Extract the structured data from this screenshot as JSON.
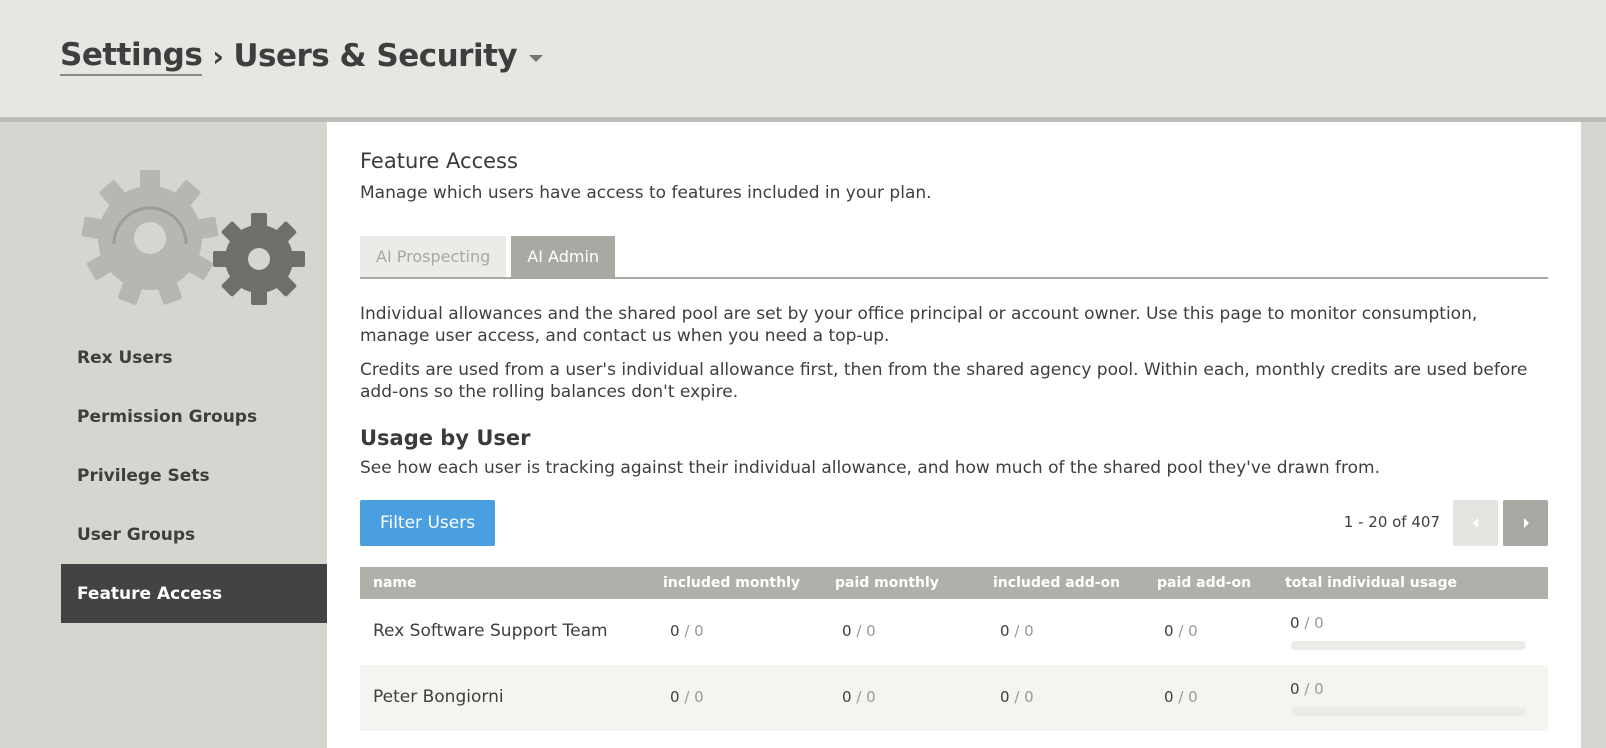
{
  "header": {
    "breadcrumb_parent": "Settings",
    "breadcrumb_separator": "›",
    "breadcrumb_current": "Users & Security"
  },
  "sidebar": {
    "items": [
      {
        "label": "Rex Users",
        "active": false
      },
      {
        "label": "Permission Groups",
        "active": false
      },
      {
        "label": "Privilege Sets",
        "active": false
      },
      {
        "label": "User Groups",
        "active": false
      },
      {
        "label": "Feature Access",
        "active": true
      }
    ]
  },
  "main": {
    "title": "Feature Access",
    "subtitle": "Manage which users have access to features included in your plan.",
    "tabs": [
      {
        "label": "AI Prospecting",
        "active": false
      },
      {
        "label": "AI Admin",
        "active": true
      }
    ],
    "paragraphs": [
      "Individual allowances and the shared pool are set by your office principal or account owner. Use this page to monitor consumption, manage user access, and contact us when you need a top-up.",
      "Credits are used from a user's individual allowance first, then from the shared agency pool. Within each, monthly credits are used before add-ons so the rolling balances don't expire."
    ],
    "usage": {
      "title": "Usage by User",
      "subtitle": "See how each user is tracking against their individual allowance, and how much of the shared pool they've drawn from.",
      "filter_label": "Filter Users",
      "pager_text": "1 - 20 of 407",
      "columns": [
        "name",
        "included monthly",
        "paid monthly",
        "included add-on",
        "paid add-on",
        "total individual usage"
      ],
      "rows": [
        {
          "name": "Rex Software Support Team",
          "included_monthly": {
            "used": "0",
            "sep": " / ",
            "total": "0"
          },
          "paid_monthly": {
            "used": "0",
            "sep": " / ",
            "total": "0"
          },
          "included_addon": {
            "used": "0",
            "sep": " / ",
            "total": "0"
          },
          "paid_addon": {
            "used": "0",
            "sep": " / ",
            "total": "0"
          },
          "total_usage": {
            "used": "0",
            "sep": " / ",
            "total": "0",
            "fraction": 0
          }
        },
        {
          "name": "Peter Bongiorni",
          "included_monthly": {
            "used": "0",
            "sep": " / ",
            "total": "0"
          },
          "paid_monthly": {
            "used": "0",
            "sep": " / ",
            "total": "0"
          },
          "included_addon": {
            "used": "0",
            "sep": " / ",
            "total": "0"
          },
          "paid_addon": {
            "used": "0",
            "sep": " / ",
            "total": "0"
          },
          "total_usage": {
            "used": "0",
            "sep": " / ",
            "total": "0",
            "fraction": 0
          }
        }
      ]
    }
  },
  "colors": {
    "accent": "#4a9fe0",
    "nav_active": "#434343",
    "table_header": "#b0b0ab"
  }
}
